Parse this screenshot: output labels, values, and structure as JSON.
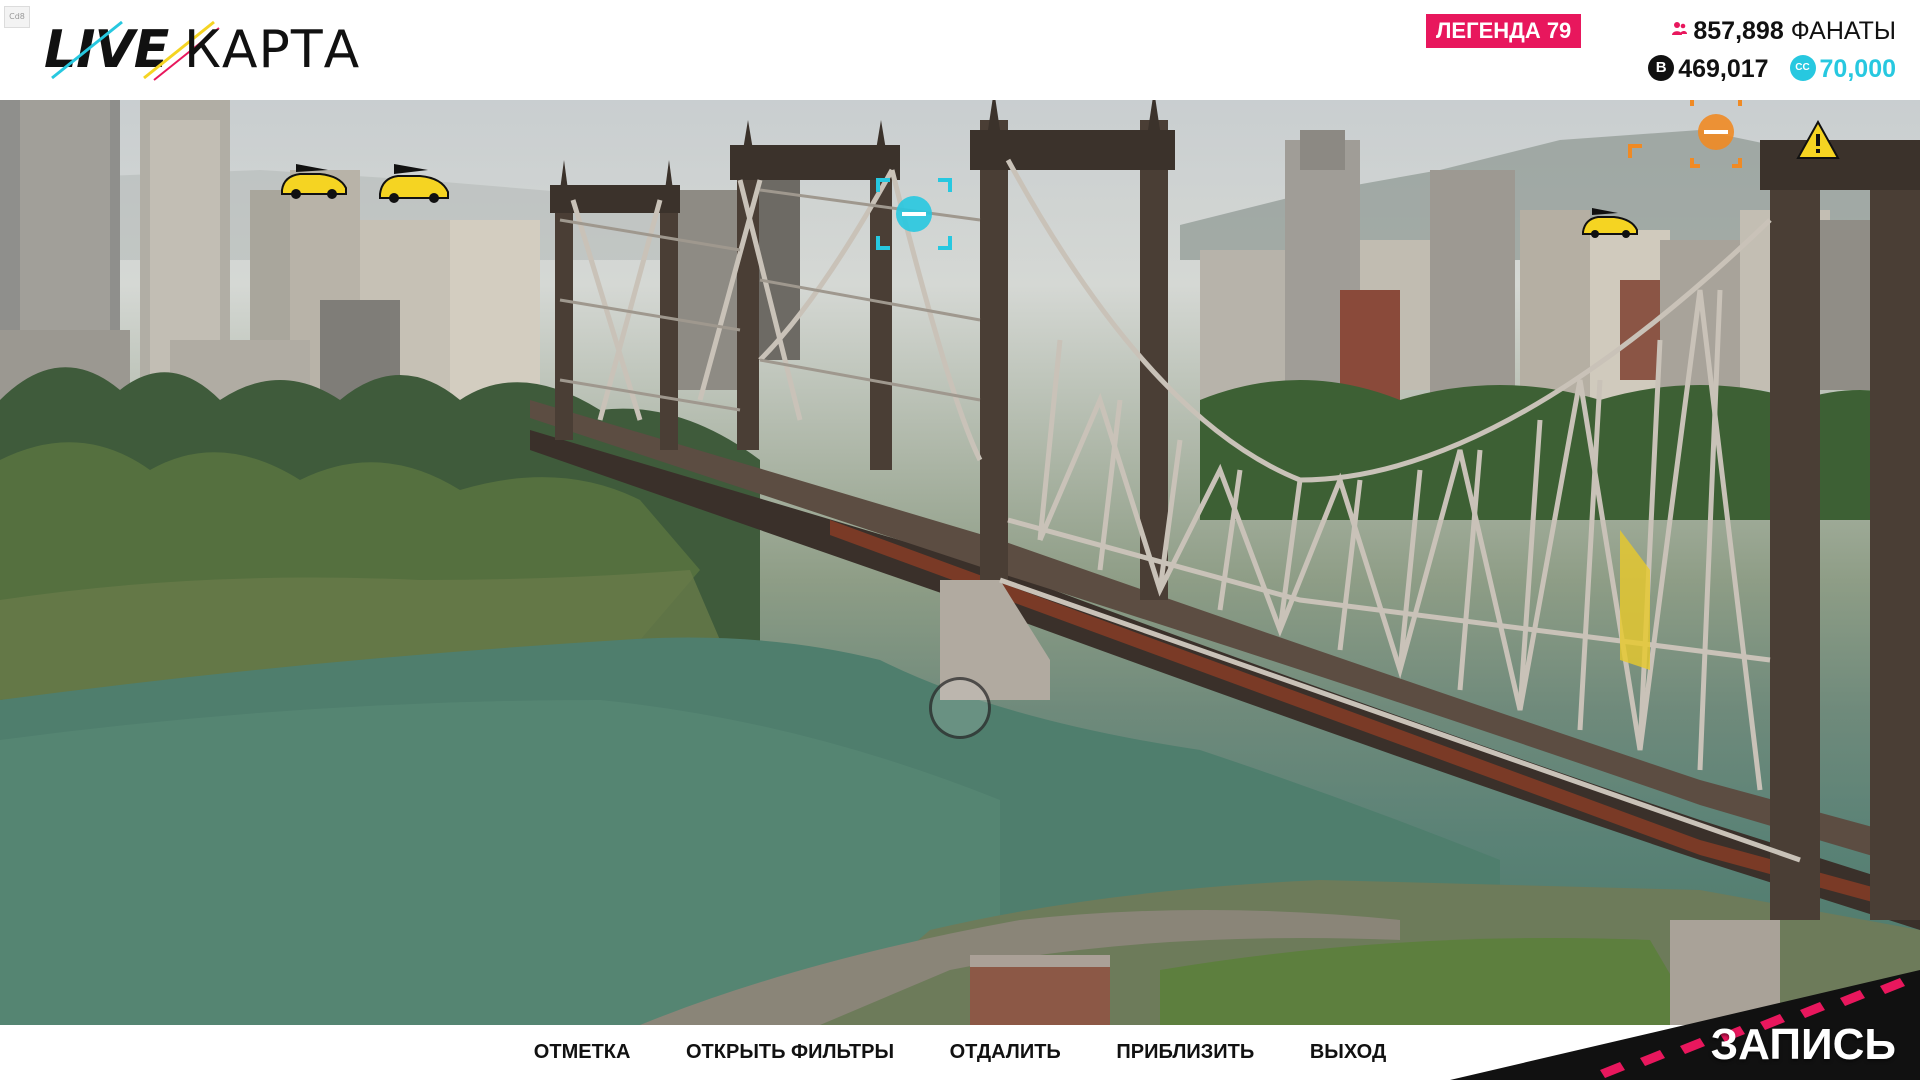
{
  "window": {
    "build_tag": "Cd8"
  },
  "logo": {
    "left": "LIVE",
    "right": "КАРТА"
  },
  "hud": {
    "level_badge": "ЛЕГЕНДА 79",
    "fans_value": "857,898",
    "fans_label": "ФАНАТЫ",
    "credits": "469,017",
    "cc_value": "70,000",
    "credits_symbol": "B",
    "cc_symbol": "CC"
  },
  "map": {
    "markers": [
      {
        "name": "car-marker-icon",
        "color": "#f5d422"
      },
      {
        "name": "car-marker-icon",
        "color": "#f5d422"
      },
      {
        "name": "target-marker-icon",
        "color": "#27c8e0"
      },
      {
        "name": "target-marker-icon",
        "color": "#f08a24"
      },
      {
        "name": "warning-marker-icon",
        "color": "#f5d422"
      },
      {
        "name": "car-marker-icon",
        "color": "#f5d422"
      }
    ]
  },
  "bottom": {
    "nav": [
      "ОТМЕТКА",
      "ОТКРЫТЬ ФИЛЬТРЫ",
      "ОТДАЛИТЬ",
      "ПРИБЛИЗИТЬ",
      "ВЫХОД"
    ],
    "record": "ЗАПИСЬ"
  },
  "colors": {
    "accent_pink": "#e8175d",
    "accent_cyan": "#27c8e0",
    "marker_yellow": "#f5d422",
    "marker_orange": "#f08a24"
  }
}
